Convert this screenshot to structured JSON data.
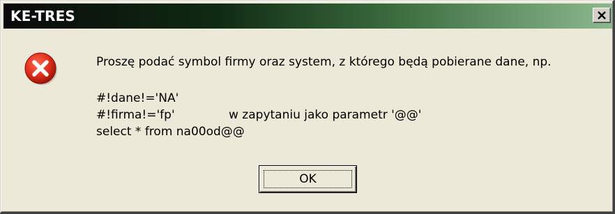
{
  "window": {
    "title": "KE-TRES",
    "close_glyph": "✕"
  },
  "icon": {
    "name": "error-icon",
    "color": "#e0301e"
  },
  "message": {
    "line1": "Proszę podać symbol firmy oraz system, z którego będą pobierane dane, np.",
    "line2": "#!dane!='NA'",
    "line3a": "#!firma!='fp'",
    "line3b": "w zapytaniu jako parametr '@@'",
    "line4": "select * from na00od@@"
  },
  "buttons": {
    "ok_label": "OK"
  }
}
